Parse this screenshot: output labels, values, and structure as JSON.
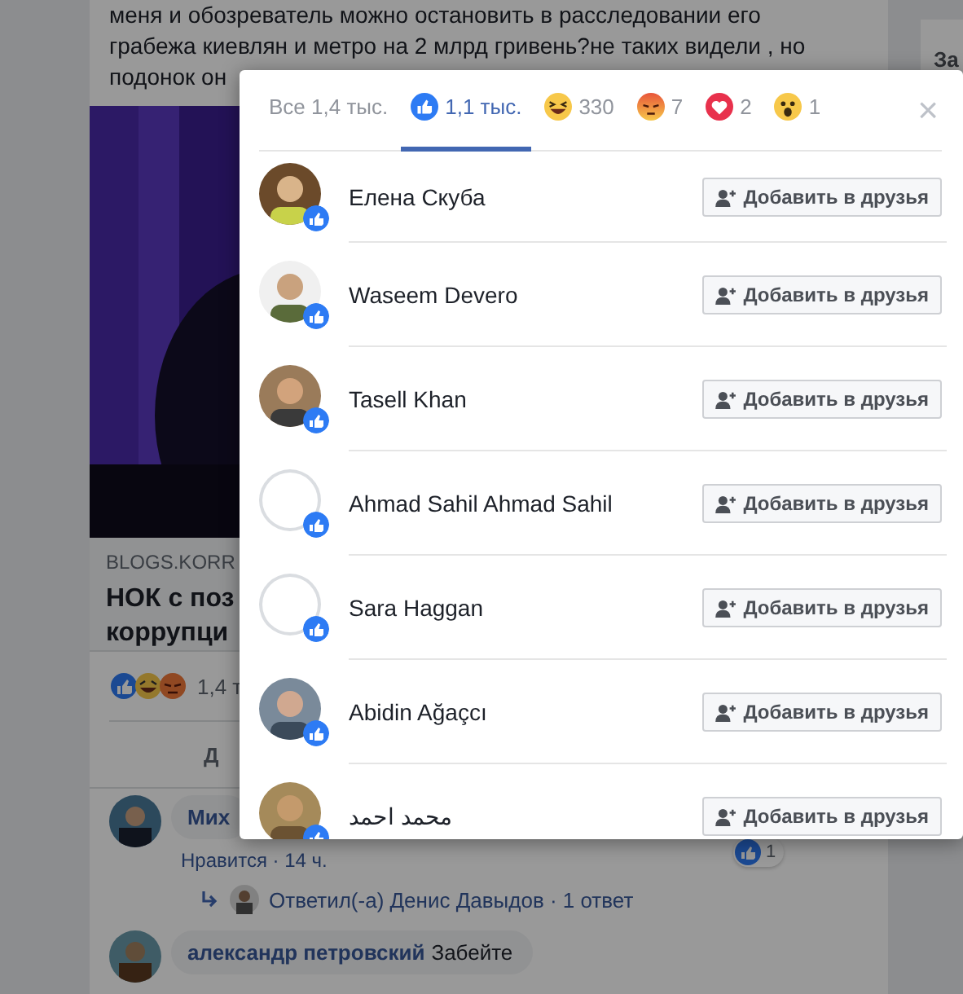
{
  "post": {
    "text_lines": [
      "меня и обозреватель можно остановить в расследовании его",
      "грабежа киевлян и метро на 2 млрд гривень?не таких видели , но",
      "подонок он"
    ],
    "link": {
      "kind": "picture",
      "domain": "BLOGS.KORR",
      "title_lines": [
        "НОК с поз",
        "коррупци"
      ]
    },
    "reactions_count": "1,4 т",
    "action_label": "Д"
  },
  "comments": [
    {
      "kind": "cut",
      "author": "Мих",
      "meta": "Нравится · 14 ч.",
      "likes": "1",
      "reply": "Ответил(-а) Денис Давыдов · 1 ответ"
    },
    {
      "kind": "full",
      "author": "александр петровский",
      "text": "Забейте"
    }
  ],
  "right_card": {
    "label": "За"
  },
  "modal": {
    "tabs": [
      {
        "kind": "all",
        "label": "Все 1,4 тыс.",
        "selected": false
      },
      {
        "kind": "like",
        "label": "1,1 тыс.",
        "selected": true
      },
      {
        "kind": "haha",
        "label": "330",
        "selected": false
      },
      {
        "kind": "angry",
        "label": "7",
        "selected": false
      },
      {
        "kind": "love",
        "label": "2",
        "selected": false
      },
      {
        "kind": "wow",
        "label": "1",
        "selected": false
      }
    ],
    "close": "×",
    "people": [
      {
        "name": "Елена Скуба",
        "kind": "picture",
        "button": "Добавить в друзья"
      },
      {
        "name": "Waseem Devero",
        "kind": "picture",
        "button": "Добавить в друзья"
      },
      {
        "name": "Tasell Khan",
        "kind": "picture",
        "button": "Добавить в друзья"
      },
      {
        "name": "Ahmad Sahil Ahmad Sahil",
        "kind": "default",
        "button": "Добавить в друзья"
      },
      {
        "name": "Sara Haggan",
        "kind": "default",
        "button": "Добавить в друзья"
      },
      {
        "name": "Abidin Ağaçcı",
        "kind": "picture",
        "button": "Добавить в друзья"
      },
      {
        "name": "محمد احمد",
        "kind": "picture",
        "button": "Добавить в друзья"
      }
    ]
  }
}
